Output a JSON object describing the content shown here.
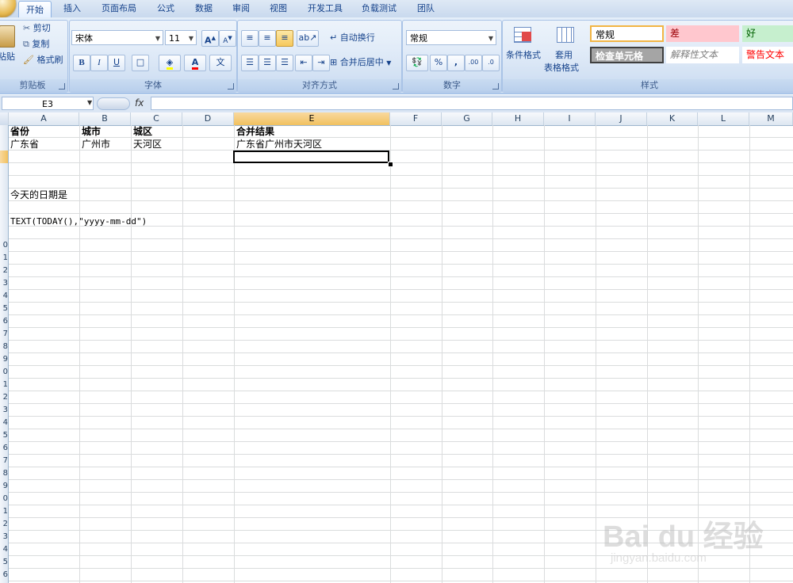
{
  "tabs": [
    "开始",
    "插入",
    "页面布局",
    "公式",
    "数据",
    "审阅",
    "视图",
    "开发工具",
    "负载测试",
    "团队"
  ],
  "clipboard": {
    "paste": "粘贴",
    "cut": "剪切",
    "copy": "复制",
    "format_painter": "格式刷",
    "group_label": "剪贴板"
  },
  "font": {
    "name": "宋体",
    "size": "11",
    "group_label": "字体",
    "bold": "B",
    "italic": "I",
    "underline": "U",
    "grow": "A",
    "shrink": "A",
    "font_color": "A",
    "phonetic": "文"
  },
  "alignment": {
    "wrap": "自动换行",
    "merge": "合并后居中",
    "group_label": "对齐方式"
  },
  "number": {
    "format": "常规",
    "percent": "%",
    "comma": ",",
    "inc_decimal": ".00",
    "dec_decimal": ".0",
    "group_label": "数字"
  },
  "styles": {
    "conditional": "条件格式",
    "table_format_1": "套用",
    "table_format_2": "表格格式",
    "normal": "常规",
    "bad": "差",
    "good": "好",
    "check_cell": "检查单元格",
    "explanatory": "解释性文本",
    "warning": "警告文本",
    "group_label": "样式"
  },
  "formula_bar": {
    "name_box": "E3",
    "fx": "fx",
    "formula": ""
  },
  "columns": [
    "A",
    "B",
    "C",
    "D",
    "E",
    "F",
    "G",
    "H",
    "I",
    "J",
    "K",
    "L",
    "M"
  ],
  "selected_column": "E",
  "cells": {
    "a1": "省份",
    "b1": "城市",
    "c1": "城区",
    "e1": "合并结果",
    "a2": "广东省",
    "b2": "广州市",
    "c2": "天河区",
    "e2": "广东省广州市天河区",
    "a6": "今天的日期是",
    "a8": "TEXT(TODAY(),\"yyyy-mm-dd\")"
  },
  "row_numbers": [
    "1",
    "2",
    "3",
    "4",
    "5",
    "6",
    "7",
    "8",
    "9",
    "0",
    "1",
    "2",
    "3",
    "4",
    "5",
    "6",
    "7",
    "8",
    "9",
    "0",
    "1",
    "2",
    "3",
    "4",
    "5",
    "6",
    "7",
    "8",
    "9",
    "0",
    "1",
    "2",
    "3",
    "4",
    "5",
    "6"
  ],
  "watermark": {
    "main": "Bai du 经验",
    "sub": "jingyan.baidu.com"
  },
  "colors": {
    "selected_header": "#f1c15f",
    "bad_bg": "#ffc7ce",
    "good_bg": "#c6efce",
    "warning_text": "#ff0000",
    "check_bg": "#a5a5a5"
  }
}
